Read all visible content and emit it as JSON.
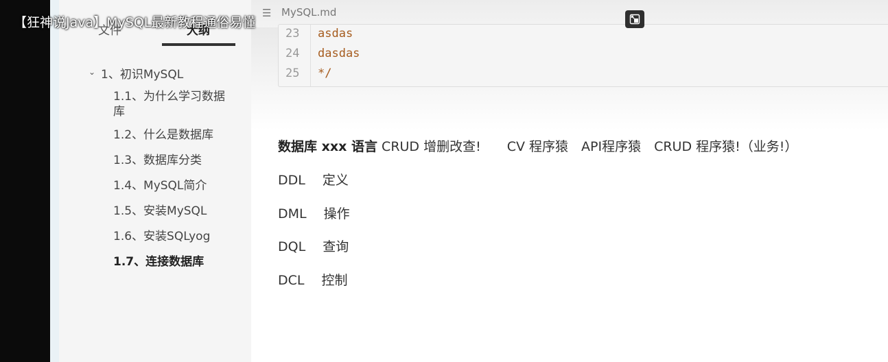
{
  "overlay": {
    "title": "【狂神说Java】MySQL最新教程通俗易懂"
  },
  "sidebar": {
    "tabs": [
      {
        "label": "文件"
      },
      {
        "label": "大纲"
      }
    ],
    "outline": [
      {
        "label": "1、初识MySQL"
      },
      {
        "label": "1.1、为什么学习数据"
      },
      {
        "label": "库"
      },
      {
        "label": "1.2、什么是数据库"
      },
      {
        "label": "1.3、数据库分类"
      },
      {
        "label": "1.4、MySQL简介"
      },
      {
        "label": "1.5、安装MySQL"
      },
      {
        "label": "1.6、安装SQLyog"
      },
      {
        "label": "1.7、连接数据库"
      }
    ]
  },
  "editor": {
    "filename": "MySQL.md",
    "code": {
      "lines": [
        {
          "no": "23",
          "text": "asdas"
        },
        {
          "no": "24",
          "text": "dasdas"
        },
        {
          "no": "25",
          "text": "*/"
        }
      ]
    },
    "paragraphs": {
      "p1_bold": "数据库 xxx 语言",
      "p1_rest": "CRUD 增删改查!　　CV 程序猿　API程序猿　CRUD 程序猿!（业务!）",
      "p2": "DDL　 定义",
      "p3": "DML　 操作",
      "p4": "DQL　 查询",
      "p5": "DCL　 控制"
    }
  },
  "icons": {
    "menu": "hamburger-icon",
    "float": "exit-picture-in-picture-icon",
    "chevron": "chevron-down-icon"
  }
}
